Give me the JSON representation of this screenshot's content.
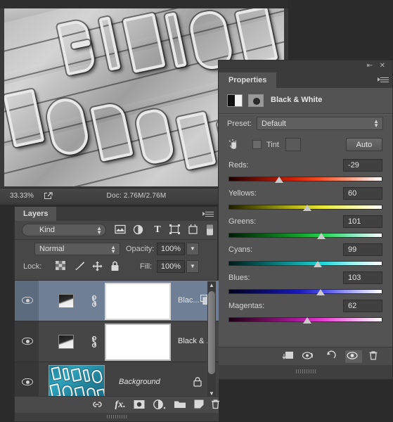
{
  "document_window": {
    "status_bar": {
      "zoom": "33.33%",
      "doc_size": "Doc: 2.76M/2.76M",
      "share_icon": "share-arrow-icon",
      "play_icon": "play-triangle-icon",
      "left_arrow_icon": "left-triangle-icon"
    },
    "canvas": {
      "description": "Black and white photograph of a neon sign with raised metal letters",
      "letters_row1": [
        "B",
        "I",
        "N",
        "I",
        "O"
      ],
      "letters_row2": [
        "H",
        "O",
        "R",
        "S",
        "E"
      ]
    }
  },
  "properties_panel": {
    "collapse_icon": "collapse-double-arrow-icon",
    "close_icon": "close-x-icon",
    "menu_icon": "panel-menu-icon",
    "tab_label": "Properties",
    "adjustment_icon": "black-white-adjustment-icon",
    "mask_icon": "layer-mask-icon",
    "title": "Black & White",
    "preset": {
      "label": "Preset:",
      "value": "Default",
      "spinner_icon": "up-down-spinner-icon"
    },
    "tint": {
      "hand_icon": "targeted-adjustment-hand-icon",
      "checkbox_checked": false,
      "label": "Tint",
      "swatch_color": "#5a5a5a"
    },
    "auto_label": "Auto",
    "sliders": [
      {
        "name": "Reds:",
        "value": "-29",
        "percent": 33.0,
        "track": "linear-gradient(90deg,#1a0000 0%,#6e0f06 18%,#cf2208 42%,#f24a20 58%,#f79c80 78%,#ffffff 100%)"
      },
      {
        "name": "Yellows:",
        "value": "60",
        "percent": 51.0,
        "track": "linear-gradient(90deg,#1d1d00 0%,#5c5c05 18%,#b5b51a 42%,#e9e93c 62%,#f6f69a 80%,#ffffff 100%)"
      },
      {
        "name": "Greens:",
        "value": "101",
        "percent": 60.5,
        "track": "linear-gradient(90deg,#001a06 0%,#0a5a18 22%,#13a02c 46%,#2ad95c 64%,#8de9c4 82%,#ffffff 100%)"
      },
      {
        "name": "Cyans:",
        "value": "99",
        "percent": 58.0,
        "track": "linear-gradient(90deg,#001a1a 0%,#075757 20%,#12a0a0 44%,#1fd8d8 62%,#9bf0f0 80%,#ffffff 100%)"
      },
      {
        "name": "Blues:",
        "value": "103",
        "percent": 60.0,
        "track": "linear-gradient(90deg,#00001a 0%,#0a0a66 22%,#1717b8 45%,#4e4ee8 62%,#b0b0f5 82%,#ffffff 100%)"
      },
      {
        "name": "Magentas:",
        "value": "62",
        "percent": 51.0,
        "track": "linear-gradient(90deg,#1a0014 0%,#5c0a48 20%,#a8179a 44%,#e83fd0 62%,#f4a6ec 82%,#ffffff 100%)"
      }
    ],
    "bottom_buttons": [
      {
        "name": "clip-to-layer-icon",
        "label": "clip to layer"
      },
      {
        "name": "view-previous-state-icon",
        "label": "view previous state"
      },
      {
        "name": "reset-icon",
        "label": "reset"
      },
      {
        "name": "toggle-visibility-icon",
        "label": "toggle layer visibility"
      },
      {
        "name": "delete-icon",
        "label": "delete adjustment layer"
      }
    ]
  },
  "layers_panel": {
    "tab_label": "Layers",
    "menu_icon": "panel-menu-icon",
    "filter": {
      "search_icon": "search-icon",
      "kind_value": "Kind",
      "spinner_icon": "up-down-spinner-icon",
      "icons": [
        "pixel-layer-filter-icon",
        "adjustment-layer-filter-icon",
        "type-layer-filter-icon",
        "shape-layer-filter-icon",
        "smart-object-filter-icon",
        "filter-toggle-switch-icon"
      ]
    },
    "blend_mode": "Normal",
    "opacity_label": "Opacity:",
    "opacity_value": "100%",
    "lock_label": "Lock:",
    "lock_icons": [
      "lock-transparent-pixels-icon",
      "lock-image-pixels-icon",
      "lock-position-icon",
      "lock-all-icon"
    ],
    "fill_label": "Fill:",
    "fill_value": "100%",
    "layers": [
      {
        "name": "Blac...",
        "type": "adjustment",
        "selected": true,
        "visible": true,
        "eye_icon": "eye-visible-icon",
        "link_icon": "link-mask-icon",
        "thumb_icon": "black-white-adjustment-thumbnail",
        "mask": "white-layer-mask",
        "extra_icon": "duplicate-mask-icon"
      },
      {
        "name": "Black & ...",
        "type": "adjustment",
        "selected": false,
        "visible": true,
        "eye_icon": "eye-visible-icon",
        "link_icon": "link-mask-icon",
        "thumb_icon": "black-white-adjustment-thumbnail",
        "mask": "white-layer-mask"
      },
      {
        "name": "Background",
        "type": "pixel",
        "selected": false,
        "visible": true,
        "italic": true,
        "eye_icon": "eye-visible-icon",
        "thumb_icon": "background-photo-thumbnail",
        "lock_icon": "locked-padlock-icon"
      }
    ],
    "scrollbar": {
      "up_arrow_icon": "scroll-up-arrow-icon",
      "down_arrow_icon": "scroll-down-arrow-icon"
    },
    "bottom_buttons": [
      {
        "name": "link-layers-icon",
        "label": "Link layers"
      },
      {
        "name": "layer-style-fx-icon",
        "label": "fx."
      },
      {
        "name": "add-layer-mask-icon",
        "label": "Add layer mask"
      },
      {
        "name": "new-adjustment-layer-icon",
        "label": "New fill or adjustment layer"
      },
      {
        "name": "new-group-icon",
        "label": "Create a new group"
      },
      {
        "name": "new-layer-icon",
        "label": "Create a new layer"
      },
      {
        "name": "delete-layer-icon",
        "label": "Delete layer"
      }
    ],
    "resize-grip-icon": "resize-grip-icon"
  },
  "colors": {
    "panel_bg": "#474747",
    "properties_bg": "#535353",
    "selection_blue": "#6e7f96",
    "text": "#d2d2d2",
    "field_bg": "#404040"
  }
}
